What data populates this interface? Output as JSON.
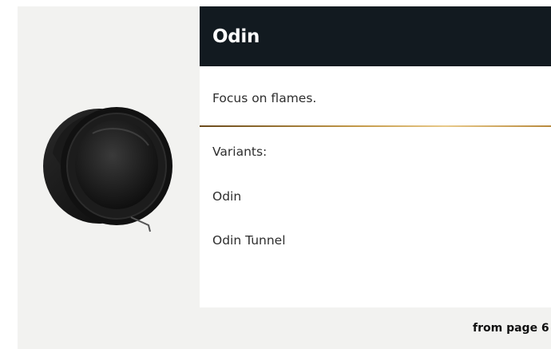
{
  "product": {
    "name": "Odin",
    "tagline": "Focus on flames.",
    "variants_label": "Variants:",
    "variants": [
      "Odin",
      "Odin Tunnel"
    ],
    "page_reference": "from page 6"
  },
  "colors": {
    "title_bar": "#121a20",
    "card_background": "#f2f2f0",
    "accent_gold": "#c49a4a"
  }
}
